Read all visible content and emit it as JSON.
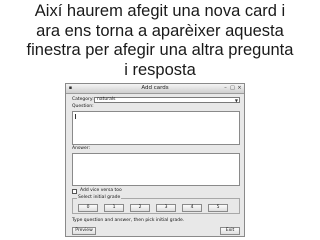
{
  "caption": {
    "line1": "Així haurem afegit una nova card i",
    "line2": "ara ens torna a aparèixer aquesta",
    "line3": "finestra per afegir una altra pregunta",
    "line4": "i resposta"
  },
  "window": {
    "title": "Add cards",
    "category_label": "Category:",
    "category_value": "naturals",
    "question_label": "Question:",
    "answer_label": "Answer:",
    "reverse_label": "Add vice versa too",
    "grade_group_title": "Select initial grade",
    "grades": [
      "0",
      "1",
      "2",
      "3",
      "4",
      "5"
    ],
    "status": "Type question and answer, then pick initial grade.",
    "preview_label": "Preview",
    "exit_label": "Exit"
  }
}
